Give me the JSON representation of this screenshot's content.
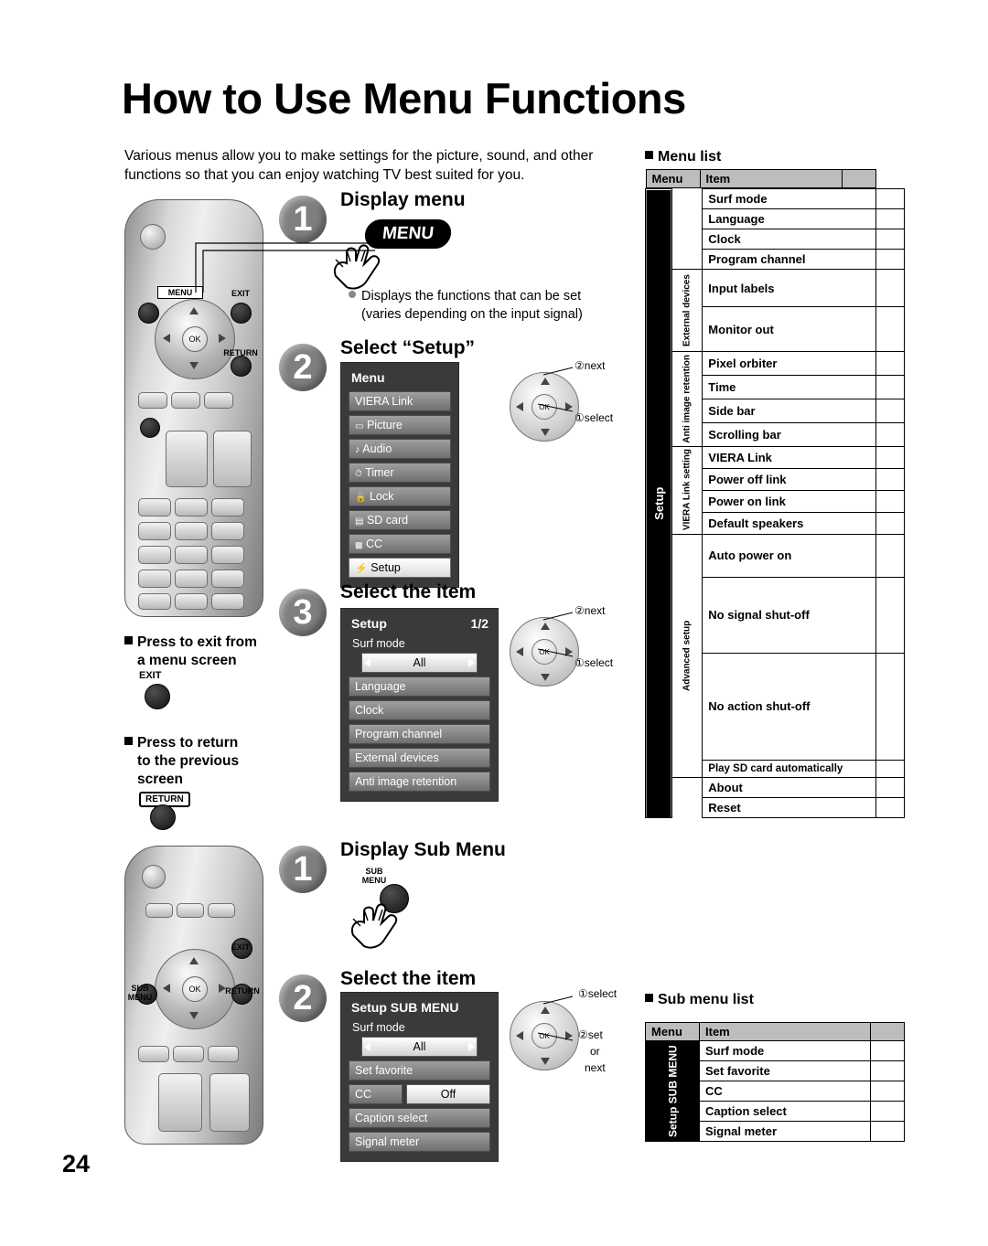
{
  "page": {
    "title": "How to Use Menu Functions",
    "number": "24",
    "intro": "Various menus allow you to make settings for the picture, sound, and other functions so that you can enjoy watching TV best suited for you."
  },
  "steps": {
    "display_menu": {
      "num": "1",
      "label": "Display menu",
      "key": "MENU"
    },
    "select_setup": {
      "num": "2",
      "label": "Select “Setup”"
    },
    "select_item": {
      "num": "3",
      "label": "Select the item"
    },
    "display_sub_menu": {
      "num": "1",
      "label": "Display Sub Menu",
      "key_line1": "SUB",
      "key_line2": "MENU"
    },
    "select_item_sub": {
      "num": "2",
      "label": "Select the item"
    }
  },
  "notes": {
    "displays_functions": "Displays the functions that can be set (varies depending on the input signal)",
    "exit_title_1": "Press to exit from",
    "exit_title_2": "a menu screen",
    "exit_key": "EXIT",
    "return_title_1": "Press to return",
    "return_title_2": "to the previous",
    "return_title_3": "screen",
    "return_key": "RETURN"
  },
  "nav_hints": {
    "next": "next",
    "select": "select",
    "set": "set",
    "or": "or",
    "next2": "next",
    "num1": "①",
    "num2": "②"
  },
  "menu_osd": {
    "title": "Menu",
    "items": [
      {
        "label": "VIERA Link",
        "icon": ""
      },
      {
        "label": "Picture",
        "icon": "▭"
      },
      {
        "label": "Audio",
        "icon": "♪"
      },
      {
        "label": "Timer",
        "icon": "⏱"
      },
      {
        "label": "Lock",
        "icon": "■"
      },
      {
        "label": "SD card",
        "icon": "▤"
      },
      {
        "label": "CC",
        "icon": "▭"
      },
      {
        "label": "Setup",
        "icon": "⚡",
        "selected": true
      }
    ]
  },
  "setup_osd": {
    "title": "Setup",
    "page": "1/2",
    "first_item": "Surf mode",
    "first_value": "All",
    "items": [
      "Language",
      "Clock",
      "Program channel",
      "External devices",
      "Anti image retention"
    ]
  },
  "sub_osd": {
    "title": "Setup SUB MENU",
    "first_item": "Surf mode",
    "first_value": "All",
    "rows": [
      {
        "label": "Set favorite",
        "value": ""
      },
      {
        "label": "CC",
        "value": "Off"
      },
      {
        "label": "Caption select",
        "value": ""
      },
      {
        "label": "Signal meter",
        "value": ""
      }
    ]
  },
  "menu_list": {
    "heading": "Menu list",
    "col_menu": "Menu",
    "col_item": "Item",
    "group_setup": "Setup",
    "subgroups": {
      "external_devices": "External devices",
      "anti_image": "Anti image retention",
      "viera_link": "VIERA Link setting",
      "advanced": "Advanced setup"
    },
    "items": [
      "Surf mode",
      "Language",
      "Clock",
      "Program channel",
      "Input labels",
      "Monitor out",
      "Pixel orbiter",
      "Time",
      "Side bar",
      "Scrolling bar",
      "VIERA Link",
      "Power off link",
      "Power on link",
      "Default speakers",
      "Auto power on",
      "No signal shut-off",
      "No action shut-off",
      "Play SD card automatically",
      "About",
      "Reset"
    ]
  },
  "sub_menu_list": {
    "heading": "Sub menu list",
    "col_menu": "Menu",
    "col_item": "Item",
    "group": "Setup SUB MENU",
    "items": [
      "Surf mode",
      "Set favorite",
      "CC",
      "Caption select",
      "Signal meter"
    ]
  },
  "remote_labels": {
    "menu": "MENU",
    "exit": "EXIT",
    "return": "RETURN",
    "ok": "OK",
    "sub": "SUB",
    "sub_menu": "MENU"
  }
}
